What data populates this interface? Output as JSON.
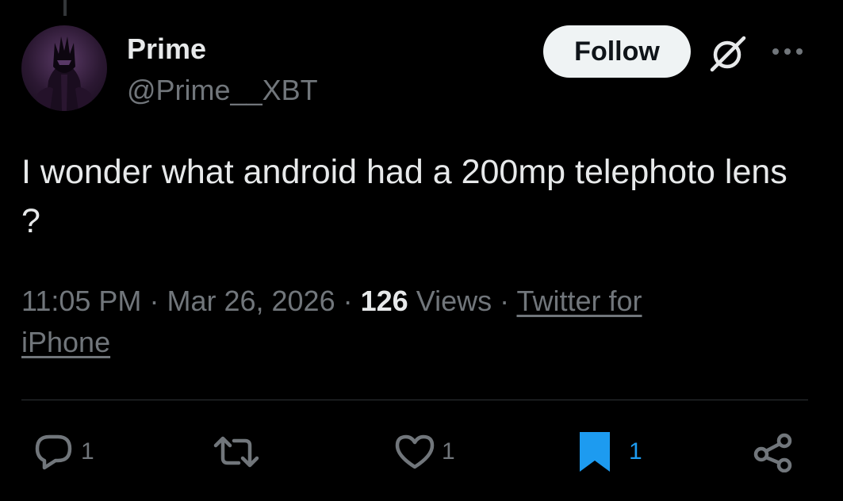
{
  "author": {
    "name": "Prime",
    "handle": "@Prime__XBT"
  },
  "header": {
    "follow_label": "Follow"
  },
  "tweet": {
    "text": "I wonder what android had a 200mp telephoto lens ?",
    "time": "11:05 PM",
    "date": "Mar 26, 2026",
    "views_count": "126",
    "views_label": "Views",
    "source": "Twitter for iPhone",
    "separator": "·"
  },
  "actions": {
    "reply_count": "1",
    "like_count": "1",
    "bookmark_count": "1"
  },
  "icons": {
    "reply": "reply-icon",
    "retweet": "retweet-icon",
    "like": "heart-icon",
    "bookmark": "bookmark-icon",
    "share": "share-icon",
    "grok": "grok-icon",
    "more": "more-icon"
  },
  "colors": {
    "background": "#000000",
    "text": "#e7e9ea",
    "muted": "#71767b",
    "accent": "#1d9bf0",
    "follow_bg": "#eff3f4"
  }
}
